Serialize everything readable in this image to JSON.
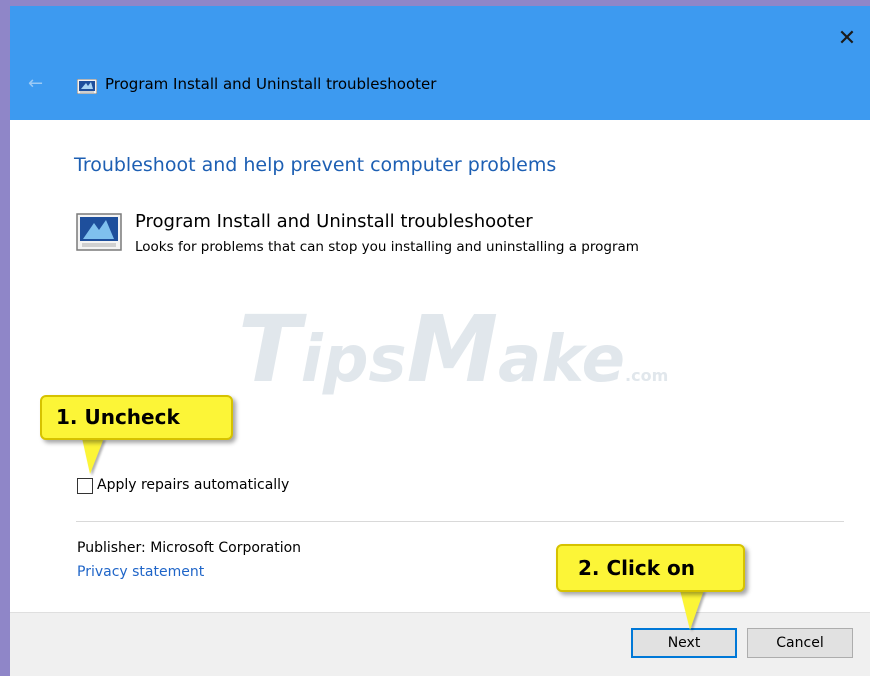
{
  "window": {
    "title": "Program Install and Uninstall troubleshooter",
    "close_glyph": "✕",
    "back_glyph": "←"
  },
  "main": {
    "heading": "Troubleshoot and help prevent computer problems",
    "troubleshooter_name": "Program Install and Uninstall troubleshooter",
    "troubleshooter_desc": "Looks for problems that can stop you installing and uninstalling a program",
    "apply_repairs_label": "Apply repairs automatically",
    "apply_repairs_checked": false,
    "publisher": "Publisher:  Microsoft Corporation",
    "privacy_link": "Privacy statement"
  },
  "watermark": {
    "t": "T",
    "ips": "ips",
    "m": "M",
    "ake": "ake",
    "com": ".com"
  },
  "callouts": {
    "step1": "1. Uncheck",
    "step2": "2. Click on"
  },
  "footer": {
    "next_label": "Next",
    "cancel_label": "Cancel"
  },
  "colors": {
    "titlebar": "#3d9af0",
    "heading": "#1d5fb3",
    "link": "#1f65c8",
    "callout": "#fcf537",
    "focus": "#0078d7"
  },
  "icons": {
    "close": "close-icon",
    "back": "back-arrow-icon",
    "app": "troubleshooter-app-icon"
  }
}
